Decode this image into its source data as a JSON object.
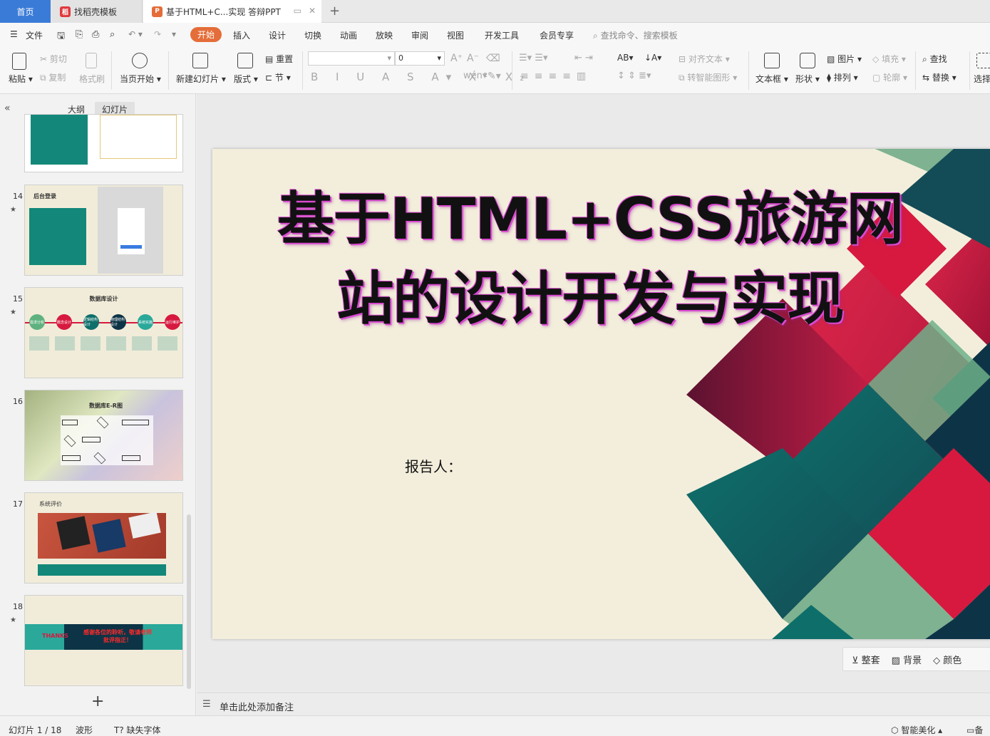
{
  "tabs": {
    "home": "首页",
    "templates": "找稻壳模板",
    "doc": "基于HTML+C...实现 答辩PPT"
  },
  "menu": [
    "文件",
    "开始",
    "插入",
    "设计",
    "切换",
    "动画",
    "放映",
    "审阅",
    "视图",
    "开发工具",
    "会员专享"
  ],
  "menu_search": "查找命令、搜索模板",
  "ribbon": {
    "paste": "粘贴",
    "cut": "剪切",
    "copy": "复制",
    "format_painter": "格式刷",
    "from_start": "当页开始",
    "new_slide": "新建幻灯片",
    "layout": "版式",
    "reset": "重置",
    "section": "节",
    "font_size": "0",
    "align_text": "对齐文本",
    "smart_shape": "转智能图形",
    "text_box": "文本框",
    "shape": "形状",
    "picture": "图片",
    "arrange": "排列",
    "fill": "填充",
    "outline": "轮廓",
    "find": "查找",
    "replace": "替换",
    "select": "选择"
  },
  "panel": {
    "outline_tab": "大纲",
    "slides_tab": "幻灯片"
  },
  "thumbnails": [
    {
      "num": "",
      "title": ""
    },
    {
      "num": "14",
      "title": "后台登录"
    },
    {
      "num": "15",
      "title": "数据库设计"
    },
    {
      "num": "16",
      "title": "数据库E-R图"
    },
    {
      "num": "17",
      "title": "系统评价"
    },
    {
      "num": "18",
      "title": "THANKS"
    }
  ],
  "thumb18_text": "感谢各位的聆听，敬请老师批评指正！",
  "thumb15_circles": [
    "需求分析",
    "概念设计",
    "逻辑结构设计",
    "物理结构设计",
    "系统实施",
    "运行维护"
  ],
  "slide": {
    "title_line1": "基于HTML+CSS旅游网",
    "title_line2": "站的设计开发与实现",
    "reporter": "报告人："
  },
  "slide_tools": [
    "整套",
    "背景",
    "颜色"
  ],
  "notes_placeholder": "单击此处添加备注",
  "status": {
    "slide_count": "幻灯片 1 / 18",
    "theme": "波形",
    "missing_font": "缺失字体",
    "beautify": "智能美化",
    "backup": "备"
  },
  "colors": {
    "accent": "#e46d39",
    "home_tab": "#3b7bd8",
    "slide_bg": "#f3eedc",
    "teal": "#0e6f6a",
    "crimson": "#d7193f",
    "navy": "#0d3446",
    "green": "#6fb08a"
  }
}
